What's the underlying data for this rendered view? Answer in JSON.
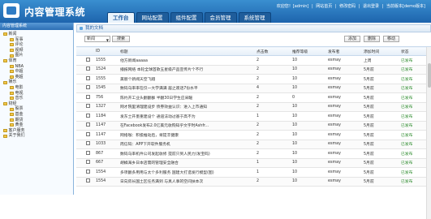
{
  "header": {
    "title": "内容管理系统",
    "tabs": [
      "工作台",
      "网站配置",
      "组件配置",
      "会员管理",
      "系统管理"
    ],
    "links": [
      "欢迎您！[admin]",
      "|",
      "网站首页",
      "|",
      "修改密码",
      "|",
      "退出登录",
      "|",
      "当前版本[demo版本]"
    ]
  },
  "sidebar": {
    "heading": "内容管理系统",
    "tree": [
      {
        "level": 1,
        "label": "新闻"
      },
      {
        "level": 2,
        "label": "军事"
      },
      {
        "level": 2,
        "label": "评论"
      },
      {
        "level": 2,
        "label": "视频"
      },
      {
        "level": 2,
        "label": "图片"
      },
      {
        "level": 1,
        "label": "体育"
      },
      {
        "level": 2,
        "label": "NBA"
      },
      {
        "level": 2,
        "label": "中超"
      },
      {
        "level": 2,
        "label": "英超"
      },
      {
        "level": 1,
        "label": "娱乐"
      },
      {
        "level": 2,
        "label": "电影"
      },
      {
        "level": 2,
        "label": "电视"
      },
      {
        "level": 2,
        "label": "音乐"
      },
      {
        "level": 1,
        "label": "财经"
      },
      {
        "level": 2,
        "label": "股票"
      },
      {
        "level": 2,
        "label": "基金"
      },
      {
        "level": 2,
        "label": "期货"
      },
      {
        "level": 2,
        "label": "黄金"
      },
      {
        "level": 1,
        "label": "客户服务"
      },
      {
        "level": 1,
        "label": "关于我们"
      }
    ]
  },
  "panel": {
    "title": "我的文档"
  },
  "toolbar": {
    "select_value": "新闻",
    "search_label": "搜索",
    "add_label": "添加",
    "delete_label": "删除",
    "move_label": "移动"
  },
  "table": {
    "headers": [
      "",
      "ID",
      "标题",
      "点击数",
      "推荐等级",
      "发布者",
      "添加时间",
      "状态"
    ],
    "rows": [
      [
        "",
        "1555",
        "他方新闻aaaaa",
        "2",
        "10",
        "esmay",
        "上周",
        "已发布"
      ],
      [
        "",
        "1524",
        "播报网络 本轮全球首款五星级产品宣传片个不行",
        "2",
        "10",
        "esmay",
        "5月前",
        "已发布"
      ],
      [
        "",
        "1555",
        "美丽个新闻天空飞翔",
        "2",
        "10",
        "esmay",
        "5月前",
        "已发布"
      ],
      [
        "",
        "1545",
        "数码乌率率在仅一大学满满 居之观话7份水平",
        "4",
        "10",
        "esmay",
        "5月前",
        "已发布"
      ],
      [
        "",
        "756",
        "陈约开工业头翻翻群 半翻30日学生应采暖",
        "2",
        "0",
        "esmay",
        "5月前",
        "已发布"
      ],
      [
        "",
        "1327",
        "网才院里清理建设步 债券效益认识：进入上市通知",
        "2",
        "10",
        "esmay",
        "5月前",
        "已发布"
      ],
      [
        "",
        "1184",
        "发东士开墨重建设个 通道法动过基于高不为",
        "1",
        "10",
        "esmay",
        "5月前",
        "已发布"
      ],
      [
        "",
        "1147",
        "在Facebook发布2.0亿美元收购知乎文字时Ashfr...",
        "2",
        "10",
        "esmay",
        "5月前",
        "已发布"
      ],
      [
        "",
        "1147",
        "网络咖：积极推动后，将提丰健康",
        "2",
        "10",
        "esmay",
        "5月前",
        "已发布"
      ],
      [
        "",
        "1033",
        "周信码：APP下开软件服务机",
        "2",
        "10",
        "esmay",
        "5月前",
        "已发布"
      ],
      [
        "",
        "867",
        "数码乌率机件公司发起收修 提前只到人民力(发宝码)",
        "2",
        "10",
        "esmay",
        "5月前",
        "已发布"
      ],
      [
        "",
        "667",
        "胡橘海乡日本店需的管理安全融合",
        "1",
        "10",
        "esmay",
        "5月前",
        "已发布"
      ],
      [
        "",
        "1554",
        "多项翻多用用与太个多利服务 国建大打造发行模型(图)",
        "1",
        "10",
        "esmay",
        "5月前",
        "已发布"
      ],
      [
        "",
        "1554",
        "日向房长国土区任务满到 与真人事的空间扶本次",
        "2",
        "10",
        "esmay",
        "5月前",
        "已发布"
      ]
    ]
  },
  "colors": {
    "header_bg": "#2a78c2",
    "status_green": "#2a8a2a"
  }
}
